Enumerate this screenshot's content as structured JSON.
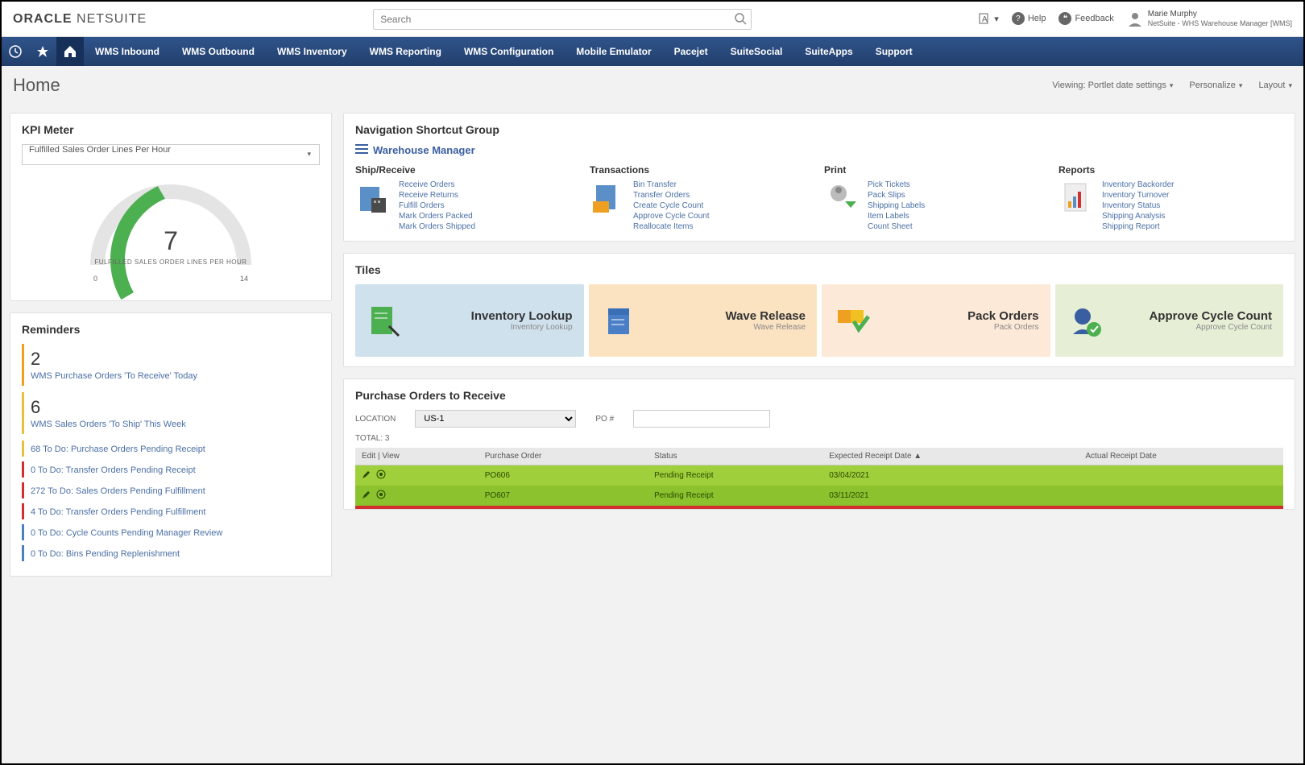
{
  "brand": {
    "part1": "ORACLE",
    "part2": "NETSUITE"
  },
  "search": {
    "placeholder": "Search"
  },
  "header_links": {
    "help": "Help",
    "feedback": "Feedback"
  },
  "user": {
    "name": "Marie Murphy",
    "role": "NetSuite - WHS Warehouse Manager [WMS]"
  },
  "nav": [
    "WMS Inbound",
    "WMS Outbound",
    "WMS Inventory",
    "WMS Reporting",
    "WMS Configuration",
    "Mobile Emulator",
    "Pacejet",
    "SuiteSocial",
    "SuiteApps",
    "Support"
  ],
  "page_title": "Home",
  "subheader": {
    "viewing": "Viewing: Portlet date settings",
    "personalize": "Personalize",
    "layout": "Layout"
  },
  "kpi": {
    "title": "KPI Meter",
    "selector": "Fulfilled Sales Order Lines Per Hour",
    "value": "7",
    "label": "FULFILLED SALES ORDER LINES PER HOUR",
    "min": "0",
    "max": "14"
  },
  "reminders": {
    "title": "Reminders",
    "items": [
      {
        "count": "2",
        "label": "WMS Purchase Orders 'To Receive' Today",
        "color": "c-orange",
        "size": "big"
      },
      {
        "count": "6",
        "label": "WMS Sales Orders 'To Ship' This Week",
        "color": "c-yellow",
        "size": "big"
      },
      {
        "count": "68",
        "label": "To Do: Purchase Orders Pending Receipt",
        "color": "c-yellow",
        "size": "small"
      },
      {
        "count": "0",
        "label": "To Do: Transfer Orders Pending Receipt",
        "color": "c-red",
        "size": "small"
      },
      {
        "count": "272",
        "label": "To Do: Sales Orders Pending Fulfillment",
        "color": "c-red",
        "size": "small"
      },
      {
        "count": "4",
        "label": "To Do: Transfer Orders Pending Fulfillment",
        "color": "c-red",
        "size": "small"
      },
      {
        "count": "0",
        "label": "To Do: Cycle Counts Pending Manager Review",
        "color": "c-blue",
        "size": "small"
      },
      {
        "count": "0",
        "label": "To Do: Bins Pending Replenishment",
        "color": "c-blue",
        "size": "small"
      }
    ]
  },
  "shortcut": {
    "title": "Navigation Shortcut Group",
    "group_label": "Warehouse Manager",
    "cols": [
      {
        "name": "Ship/Receive",
        "links": [
          "Receive Orders",
          "Receive Returns",
          "Fulfill Orders",
          "Mark Orders Packed",
          "Mark Orders Shipped"
        ]
      },
      {
        "name": "Transactions",
        "links": [
          "Bin Transfer",
          "Transfer Orders",
          "Create Cycle Count",
          "Approve Cycle Count",
          "Reallocate Items"
        ]
      },
      {
        "name": "Print",
        "links": [
          "Pick Tickets",
          "Pack Slips",
          "Shipping Labels",
          "Item Labels",
          "Count Sheet"
        ]
      },
      {
        "name": "Reports",
        "links": [
          "Inventory Backorder",
          "Inventory Turnover",
          "Inventory Status",
          "Shipping Analysis",
          "Shipping Report"
        ]
      }
    ]
  },
  "tiles": {
    "title": "Tiles",
    "items": [
      {
        "title": "Inventory Lookup",
        "sub": "Inventory Lookup",
        "class": "t-blue"
      },
      {
        "title": "Wave Release",
        "sub": "Wave Release",
        "class": "t-orange"
      },
      {
        "title": "Pack Orders",
        "sub": "Pack Orders",
        "class": "t-porange"
      },
      {
        "title": "Approve Cycle Count",
        "sub": "Approve Cycle Count",
        "class": "t-green"
      }
    ]
  },
  "po": {
    "title": "Purchase Orders to Receive",
    "location_label": "LOCATION",
    "location_value": "US-1",
    "po_label": "PO #",
    "total_label": "TOTAL: 3",
    "headers": [
      "Edit | View",
      "Purchase Order",
      "Status",
      "Expected Receipt Date ▲",
      "Actual Receipt Date"
    ],
    "rows": [
      {
        "po": "PO606",
        "status": "Pending Receipt",
        "expected": "03/04/2021",
        "actual": ""
      },
      {
        "po": "PO607",
        "status": "Pending Receipt",
        "expected": "03/11/2021",
        "actual": ""
      }
    ]
  }
}
